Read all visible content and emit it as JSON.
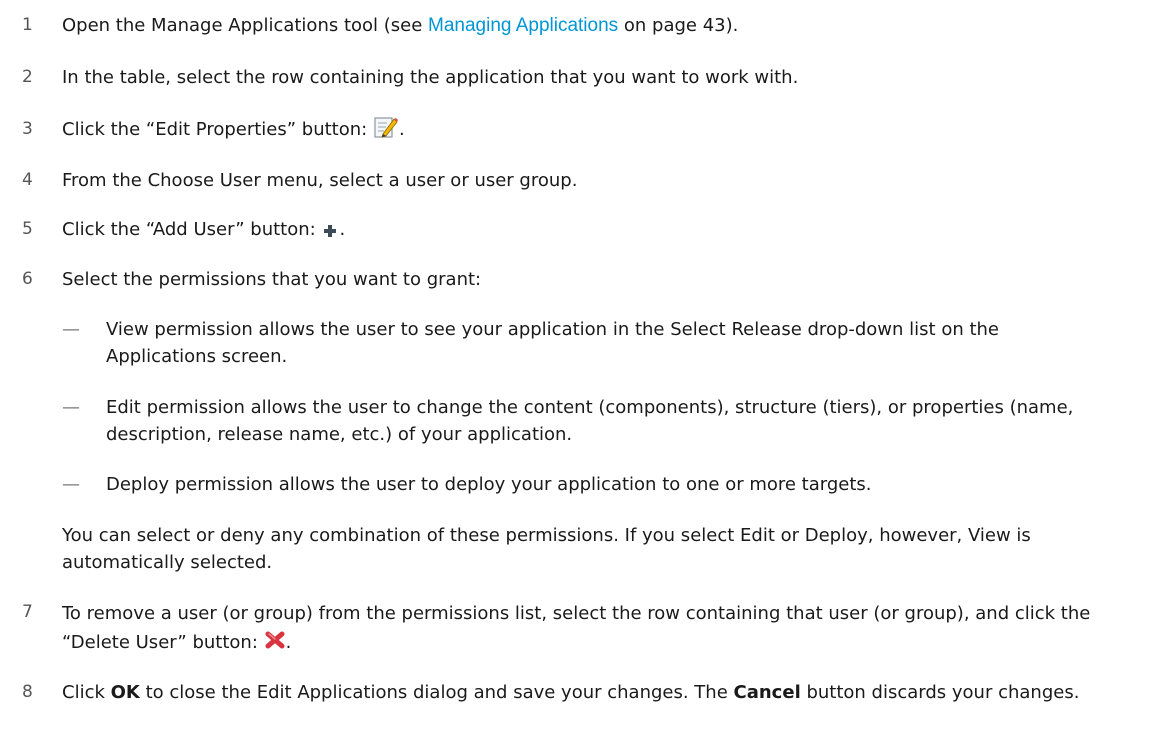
{
  "steps": [
    {
      "num": "1",
      "pre": "Open the Manage Applications tool (see ",
      "link": "Managing Applications",
      "post": " on page 43)."
    },
    {
      "num": "2",
      "text": "In the table, select the row containing the application that you want to work with."
    },
    {
      "num": "3",
      "pre": "Click the “Edit Properties” button: ",
      "icon": "edit-properties-icon",
      "post": "."
    },
    {
      "num": "4",
      "text": "From the Choose User menu, select a user or user group."
    },
    {
      "num": "5",
      "pre": "Click the “Add User” button: ",
      "icon": "plus-icon",
      "post": "."
    },
    {
      "num": "6",
      "text": "Select the permissions that you want to grant:"
    },
    {
      "num": "7",
      "pre": "To remove a user (or group) from the permissions list, select the row containing that user (or group), and click the “Delete User” button: ",
      "icon": "red-x-icon",
      "post": "."
    },
    {
      "num": "8",
      "pre": "Click ",
      "bold1": "OK",
      "mid": " to close the Edit Applications dialog and save your changes. The ",
      "bold2": "Cancel",
      "post": " button discards your changes."
    }
  ],
  "bullets": [
    {
      "dash": "—",
      "text": "View permission allows the user to see your application in the Select Release drop-down list on the Applications screen."
    },
    {
      "dash": "—",
      "text": "Edit permission allows the user to change the content (components), structure (tiers), or properties (name, description, release name, etc.) of your application."
    },
    {
      "dash": "—",
      "text": "Deploy permission allows the user to deploy your application to one or more targets."
    }
  ],
  "note": "You can select or deny any combination of these permissions. If you select Edit or Deploy, however, View is automatically selected.",
  "colors": {
    "link": "#0096d6",
    "number": "#555555",
    "dash": "#777777",
    "delete_icon": "#d9333f"
  }
}
